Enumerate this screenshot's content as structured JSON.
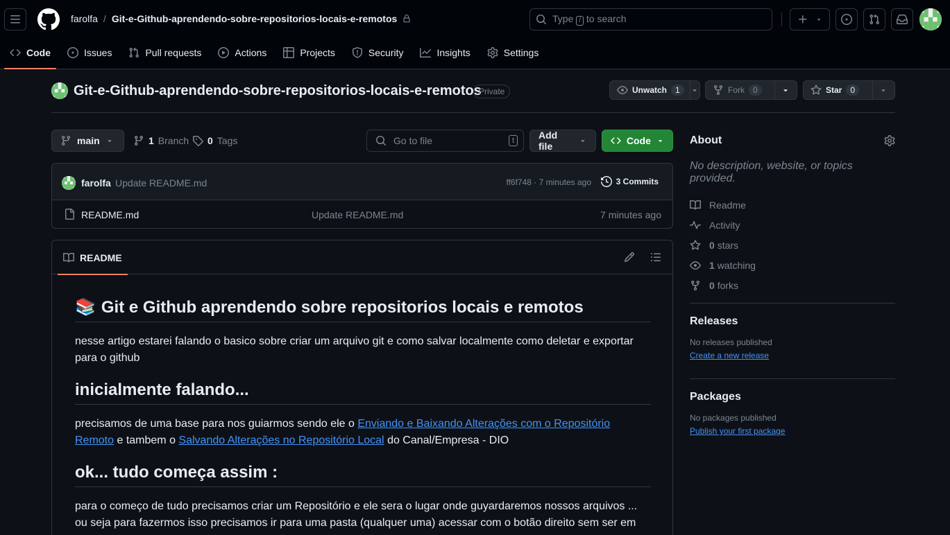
{
  "header": {
    "owner": "farolfa",
    "separator": "/",
    "repo": "Git-e-Github-aprendendo-sobre-repositorios-locais-e-remotos",
    "search_prefix": "Type",
    "search_key": "/",
    "search_suffix": "to search"
  },
  "tabs": [
    {
      "label": "Code",
      "icon": "code-icon"
    },
    {
      "label": "Issues",
      "icon": "issue-icon"
    },
    {
      "label": "Pull requests",
      "icon": "pull-request-icon"
    },
    {
      "label": "Actions",
      "icon": "play-icon"
    },
    {
      "label": "Projects",
      "icon": "table-icon"
    },
    {
      "label": "Security",
      "icon": "shield-icon"
    },
    {
      "label": "Insights",
      "icon": "graph-icon"
    },
    {
      "label": "Settings",
      "icon": "gear-icon"
    }
  ],
  "repo": {
    "title": "Git-e-Github-aprendendo-sobre-repositorios-locais-e-remotos",
    "visibility": "Private",
    "unwatch_label": "Unwatch",
    "watch_count": "1",
    "fork_label": "Fork",
    "fork_count": "0",
    "star_label": "Star",
    "star_count": "0"
  },
  "toolbar": {
    "branch": "main",
    "branch_count": "1",
    "branch_label": "Branch",
    "tag_count": "0",
    "tag_label": "Tags",
    "goto_placeholder": "Go to file",
    "goto_key": "t",
    "add_file": "Add file",
    "code": "Code"
  },
  "latest_commit": {
    "user": "farolfa",
    "message": "Update README.md",
    "hash_time": "ff6f748 · 7 minutes ago",
    "commits": "3 Commits"
  },
  "files": [
    {
      "name": "README.md",
      "message": "Update README.md",
      "time": "7 minutes ago"
    }
  ],
  "readme": {
    "tab_label": "README",
    "h1_emoji": "📚",
    "h1": "Git e Github aprendendo sobre repositorios locais e remotos",
    "p1": "nesse artigo estarei falando o basico sobre criar um arquivo git e como salvar localmente como deletar e exportar para o github",
    "h2a": "inicialmente falando...",
    "p2_text1": "precisamos de uma base para nos guiarmos sendo ele o",
    "p2_link1": "Enviando e Baixando Alterações com o Repositório Remoto",
    "p2_text2": "e tambem o",
    "p2_link2": "Salvando Alterações no Repositório Local",
    "p2_text3": "do Canal/Empresa - DIO",
    "h2b": "ok... tudo começa assim :",
    "p3": "para o começo de tudo precisamos criar um Repositório e ele sera o lugar onde guyardaremos nossos arquivos ... ou seja para fazermos isso precisamos ir para uma pasta (qualquer uma) acessar com o botão direito sem ser em um"
  },
  "about": {
    "title": "About",
    "description": "No description, website, or topics provided.",
    "items": [
      {
        "icon": "book-icon",
        "count": "",
        "label": "Readme"
      },
      {
        "icon": "pulse-icon",
        "count": "",
        "label": "Activity"
      },
      {
        "icon": "star-icon",
        "count": "0",
        "label": "stars"
      },
      {
        "icon": "eye-icon",
        "count": "1",
        "label": "watching"
      },
      {
        "icon": "fork-icon",
        "count": "0",
        "label": "forks"
      }
    ]
  },
  "releases": {
    "title": "Releases",
    "empty": "No releases published",
    "link": "Create a new release"
  },
  "packages": {
    "title": "Packages",
    "empty": "No packages published",
    "link": "Publish your first package"
  },
  "colors": {
    "accent_tab": "#f78166",
    "primary_button": "#238636",
    "link": "#4493f8",
    "background": "#0d1117"
  }
}
